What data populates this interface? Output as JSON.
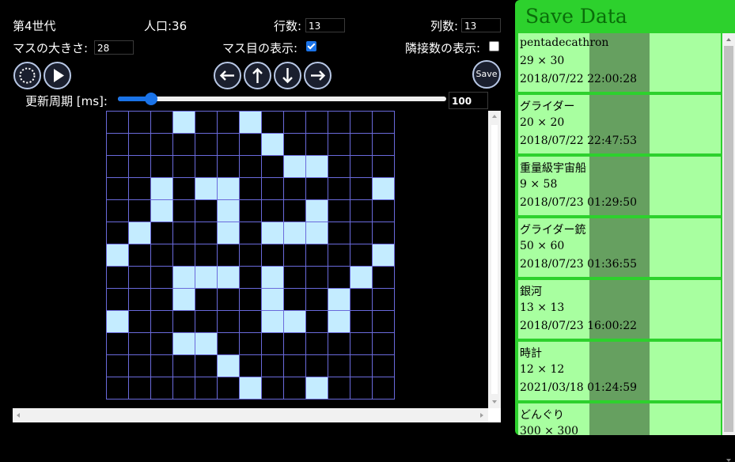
{
  "header": {
    "generation": "第4世代",
    "population": "人口:36",
    "rows_label": "行数:",
    "rows_value": "13",
    "cols_label": "列数:",
    "cols_value": "13",
    "cell_size_label": "マスの大きさ:",
    "cell_size_value": "28",
    "show_grid_label": "マス目の表示:",
    "show_grid_checked": true,
    "show_neighbors_label": "隣接数の表示:",
    "show_neighbors_checked": false,
    "update_period_label": "更新周期 [ms]:",
    "update_period_value": "100",
    "slider_fraction": 0.1
  },
  "toolbar": {
    "buttons": [
      {
        "name": "reset-button",
        "icon": "loading-spinner-icon"
      },
      {
        "name": "play-button",
        "icon": "play-icon"
      },
      {
        "name": "shift-left-button",
        "icon": "arrow-left-icon"
      },
      {
        "name": "shift-up-button",
        "icon": "arrow-up-icon"
      },
      {
        "name": "shift-down-button",
        "icon": "arrow-down-icon"
      },
      {
        "name": "shift-right-button",
        "icon": "arrow-right-icon"
      }
    ],
    "save_label": "Save"
  },
  "board": {
    "rows": 13,
    "cols": 13,
    "alive_color": "#c4ecff",
    "grid_line_color": "#6a6adb",
    "cells": [
      [
        0,
        3
      ],
      [
        0,
        6
      ],
      [
        1,
        7
      ],
      [
        2,
        8
      ],
      [
        2,
        9
      ],
      [
        3,
        2
      ],
      [
        3,
        4
      ],
      [
        3,
        5
      ],
      [
        3,
        12
      ],
      [
        4,
        2
      ],
      [
        4,
        5
      ],
      [
        4,
        9
      ],
      [
        5,
        1
      ],
      [
        5,
        5
      ],
      [
        5,
        7
      ],
      [
        5,
        8
      ],
      [
        5,
        9
      ],
      [
        6,
        0
      ],
      [
        6,
        12
      ],
      [
        7,
        3
      ],
      [
        7,
        4
      ],
      [
        7,
        5
      ],
      [
        7,
        7
      ],
      [
        7,
        11
      ],
      [
        8,
        3
      ],
      [
        8,
        7
      ],
      [
        8,
        10
      ],
      [
        9,
        0
      ],
      [
        9,
        7
      ],
      [
        9,
        8
      ],
      [
        9,
        10
      ],
      [
        10,
        3
      ],
      [
        10,
        4
      ],
      [
        11,
        5
      ],
      [
        12,
        6
      ],
      [
        12,
        9
      ]
    ]
  },
  "save_panel": {
    "title": "Save Data",
    "panel_color": "#2dd12d",
    "items": [
      {
        "name": "pentadecathron",
        "size": "29 × 30",
        "date": "2018/07/22 22:00:28"
      },
      {
        "name": "グライダー",
        "size": "20 × 20",
        "date": "2018/07/22 22:47:53"
      },
      {
        "name": "重量級宇宙船",
        "size": "9 × 58",
        "date": "2018/07/23 01:29:50"
      },
      {
        "name": "グライダー銃",
        "size": "50 × 60",
        "date": "2018/07/23 01:36:55"
      },
      {
        "name": "銀河",
        "size": "13 × 13",
        "date": "2018/07/23 16:00:22"
      },
      {
        "name": "時計",
        "size": "12 × 12",
        "date": "2021/03/18 01:24:59"
      },
      {
        "name": "どんぐり",
        "size": "300 × 300",
        "date": ""
      }
    ]
  }
}
